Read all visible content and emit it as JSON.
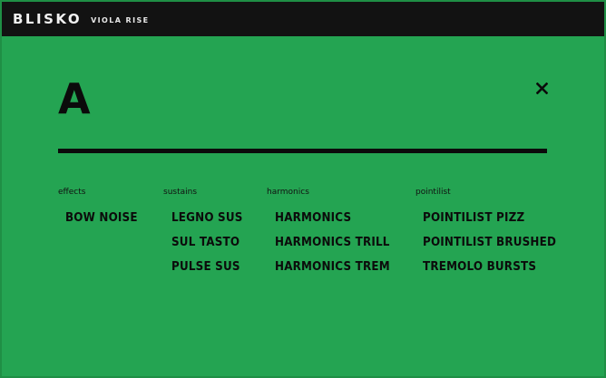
{
  "header": {
    "brand": "BLISKO",
    "product": "VIOLA RISE"
  },
  "panel": {
    "letter": "A",
    "close_icon": "close-icon"
  },
  "categories": [
    {
      "label": "effects",
      "items": [
        "BOW NOISE"
      ]
    },
    {
      "label": "sustains",
      "items": [
        "LEGNO SUS",
        "SUL TASTO",
        "PULSE SUS"
      ]
    },
    {
      "label": "harmonics",
      "items": [
        "HARMONICS",
        "HARMONICS TRILL",
        "HARMONICS TREM"
      ]
    },
    {
      "label": "pointilist",
      "items": [
        "POINTILIST PIZZ",
        "POINTILIST BRUSHED",
        "TREMOLO BURSTS"
      ]
    }
  ],
  "colors": {
    "background": "#24a452",
    "topbar": "#121212",
    "text": "#0b0b0b"
  }
}
